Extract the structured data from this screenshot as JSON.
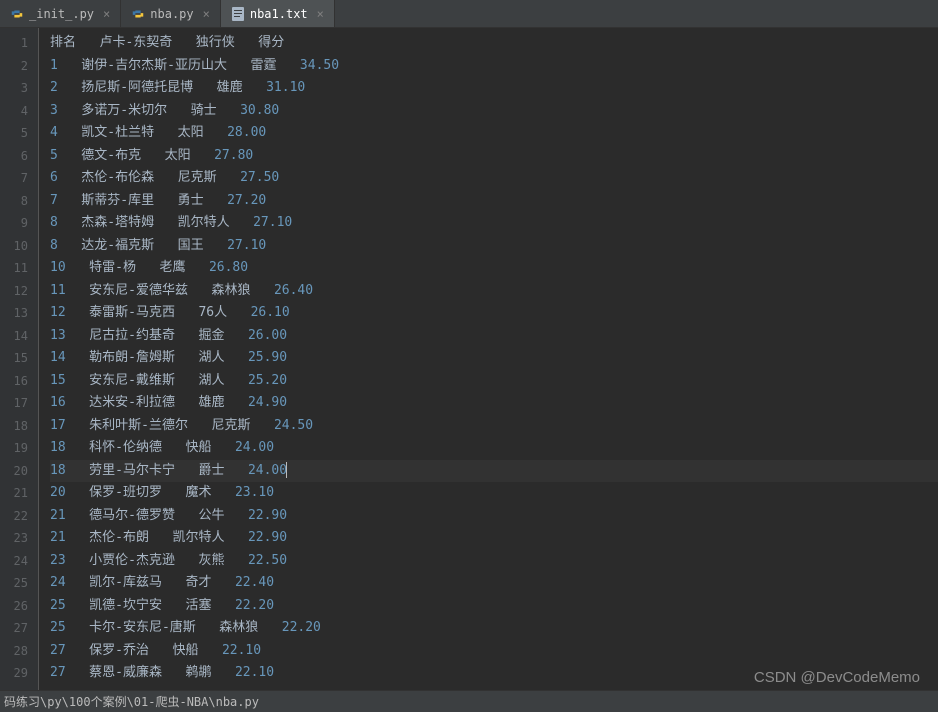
{
  "tabs": [
    {
      "label": "_init_.py",
      "type": "py",
      "active": false
    },
    {
      "label": "nba.py",
      "type": "py",
      "active": false
    },
    {
      "label": "nba1.txt",
      "type": "txt",
      "active": true
    }
  ],
  "header_line": "排名   卢卡-东契奇   独行侠   得分",
  "rows": [
    {
      "rank": "1",
      "name": "谢伊-吉尔杰斯-亚历山大",
      "team": "雷霆",
      "score": "34.50"
    },
    {
      "rank": "2",
      "name": "扬尼斯-阿德托昆博",
      "team": "雄鹿",
      "score": "31.10"
    },
    {
      "rank": "3",
      "name": "多诺万-米切尔",
      "team": "骑士",
      "score": "30.80"
    },
    {
      "rank": "4",
      "name": "凯文-杜兰特",
      "team": "太阳",
      "score": "28.00"
    },
    {
      "rank": "5",
      "name": "德文-布克",
      "team": "太阳",
      "score": "27.80"
    },
    {
      "rank": "6",
      "name": "杰伦-布伦森",
      "team": "尼克斯",
      "score": "27.50"
    },
    {
      "rank": "7",
      "name": "斯蒂芬-库里",
      "team": "勇士",
      "score": "27.20"
    },
    {
      "rank": "8",
      "name": "杰森-塔特姆",
      "team": "凯尔特人",
      "score": "27.10"
    },
    {
      "rank": "8",
      "name": "达龙-福克斯",
      "team": "国王",
      "score": "27.10"
    },
    {
      "rank": "10",
      "name": "特雷-杨",
      "team": "老鹰",
      "score": "26.80"
    },
    {
      "rank": "11",
      "name": "安东尼-爱德华兹",
      "team": "森林狼",
      "score": "26.40"
    },
    {
      "rank": "12",
      "name": "泰雷斯-马克西",
      "team": "76人",
      "score": "26.10"
    },
    {
      "rank": "13",
      "name": "尼古拉-约基奇",
      "team": "掘金",
      "score": "26.00"
    },
    {
      "rank": "14",
      "name": "勒布朗-詹姆斯",
      "team": "湖人",
      "score": "25.90"
    },
    {
      "rank": "15",
      "name": "安东尼-戴维斯",
      "team": "湖人",
      "score": "25.20"
    },
    {
      "rank": "16",
      "name": "达米安-利拉德",
      "team": "雄鹿",
      "score": "24.90"
    },
    {
      "rank": "17",
      "name": "朱利叶斯-兰德尔",
      "team": "尼克斯",
      "score": "24.50"
    },
    {
      "rank": "18",
      "name": "科怀-伦纳德",
      "team": "快船",
      "score": "24.00"
    },
    {
      "rank": "18",
      "name": "劳里-马尔卡宁",
      "team": "爵士",
      "score": "24.00",
      "current": true
    },
    {
      "rank": "20",
      "name": "保罗-班切罗",
      "team": "魔术",
      "score": "23.10"
    },
    {
      "rank": "21",
      "name": "德马尔-德罗赞",
      "team": "公牛",
      "score": "22.90"
    },
    {
      "rank": "21",
      "name": "杰伦-布朗",
      "team": "凯尔特人",
      "score": "22.90"
    },
    {
      "rank": "23",
      "name": "小贾伦-杰克逊",
      "team": "灰熊",
      "score": "22.50"
    },
    {
      "rank": "24",
      "name": "凯尔-库兹马",
      "team": "奇才",
      "score": "22.40"
    },
    {
      "rank": "25",
      "name": "凯德-坎宁安",
      "team": "活塞",
      "score": "22.20"
    },
    {
      "rank": "25",
      "name": "卡尔-安东尼-唐斯",
      "team": "森林狼",
      "score": "22.20"
    },
    {
      "rank": "27",
      "name": "保罗-乔治",
      "team": "快船",
      "score": "22.10"
    },
    {
      "rank": "27",
      "name": "蔡恩-威廉森",
      "team": "鹈鹕",
      "score": "22.10"
    }
  ],
  "gutter_lines": [
    "1",
    "2",
    "3",
    "4",
    "5",
    "6",
    "7",
    "8",
    "9",
    "10",
    "11",
    "12",
    "13",
    "14",
    "15",
    "16",
    "17",
    "18",
    "19",
    "20",
    "21",
    "22",
    "23",
    "24",
    "25",
    "26",
    "27",
    "28",
    "29"
  ],
  "status_path": "码练习\\py\\100个案例\\01-爬虫-NBA\\nba.py",
  "watermark": "CSDN @DevCodeMemo"
}
